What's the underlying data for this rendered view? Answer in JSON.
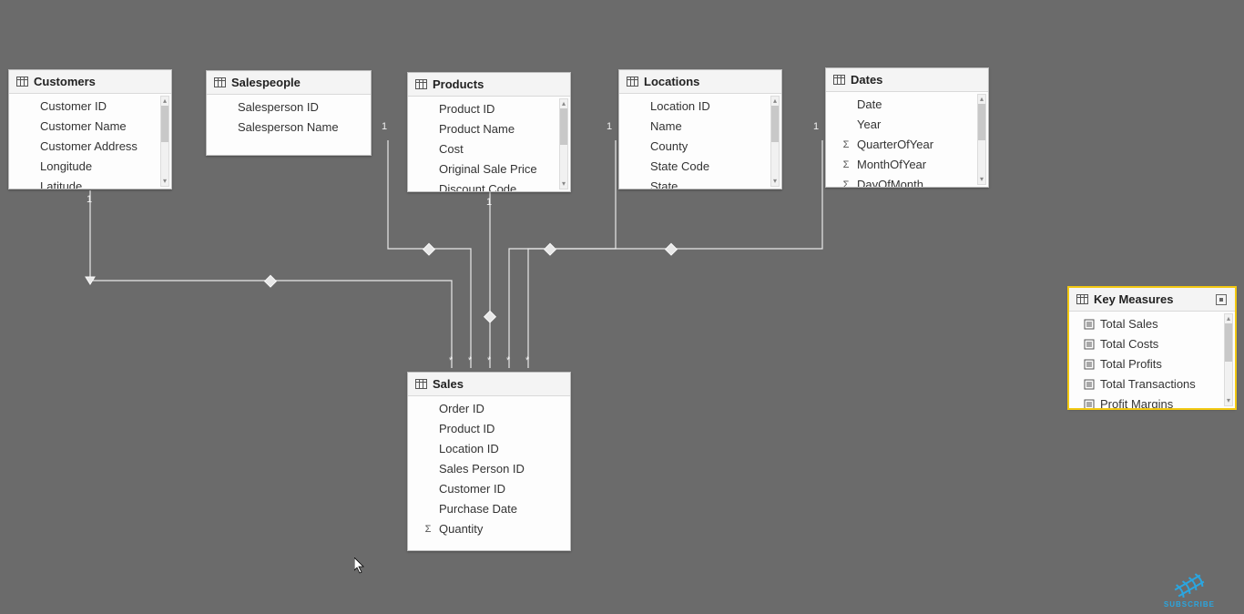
{
  "tables": {
    "customers": {
      "title": "Customers",
      "fields": [
        {
          "label": "Customer ID"
        },
        {
          "label": "Customer Name"
        },
        {
          "label": "Customer Address"
        },
        {
          "label": "Longitude"
        },
        {
          "label": "Latitude"
        }
      ]
    },
    "salespeople": {
      "title": "Salespeople",
      "fields": [
        {
          "label": "Salesperson ID"
        },
        {
          "label": "Salesperson Name"
        }
      ]
    },
    "products": {
      "title": "Products",
      "fields": [
        {
          "label": "Product ID"
        },
        {
          "label": "Product Name"
        },
        {
          "label": "Cost"
        },
        {
          "label": "Original Sale Price"
        },
        {
          "label": "Discount Code"
        }
      ]
    },
    "locations": {
      "title": "Locations",
      "fields": [
        {
          "label": "Location ID"
        },
        {
          "label": "Name"
        },
        {
          "label": "County"
        },
        {
          "label": "State Code"
        },
        {
          "label": "State"
        }
      ]
    },
    "dates": {
      "title": "Dates",
      "fields": [
        {
          "label": "Date"
        },
        {
          "label": "Year"
        },
        {
          "label": "QuarterOfYear",
          "icon": "sigma"
        },
        {
          "label": "MonthOfYear",
          "icon": "sigma"
        },
        {
          "label": "DayOfMonth",
          "icon": "sigma"
        }
      ]
    },
    "sales": {
      "title": "Sales",
      "fields": [
        {
          "label": "Order ID"
        },
        {
          "label": "Product ID"
        },
        {
          "label": "Location ID"
        },
        {
          "label": "Sales Person ID"
        },
        {
          "label": "Customer ID"
        },
        {
          "label": "Purchase Date"
        },
        {
          "label": "Quantity",
          "icon": "sigma"
        }
      ]
    },
    "keymeasures": {
      "title": "Key Measures",
      "fields": [
        {
          "label": "Total Sales",
          "icon": "calc"
        },
        {
          "label": "Total Costs",
          "icon": "calc"
        },
        {
          "label": "Total Profits",
          "icon": "calc"
        },
        {
          "label": "Total Transactions",
          "icon": "calc"
        },
        {
          "label": "Profit Margins",
          "icon": "calc"
        }
      ]
    }
  },
  "cardinality": {
    "one": "1",
    "many": "*"
  },
  "badge": {
    "label": "SUBSCRIBE"
  }
}
